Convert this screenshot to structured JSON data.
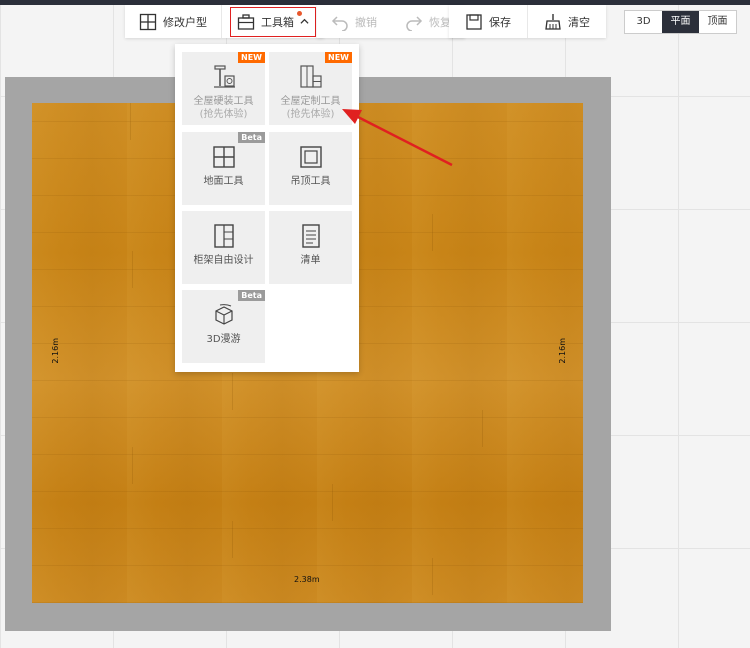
{
  "toolbar": {
    "edit_floorplan": "修改户型",
    "toolbox": "工具箱",
    "undo": "撤销",
    "redo": "恢复",
    "save": "保存",
    "clear": "清空"
  },
  "view_modes": [
    "3D",
    "平面",
    "顶面"
  ],
  "active_view": "平面",
  "dropdown": {
    "tiles": [
      {
        "label": "全屋硬装工具",
        "sub": "(抢先体验)",
        "badge": "NEW",
        "icon": "hard-decoration-icon"
      },
      {
        "label": "全屋定制工具",
        "sub": "(抢先体验)",
        "badge": "NEW",
        "icon": "custom-cabinet-icon"
      },
      {
        "label": "地面工具",
        "badge": "Beta",
        "icon": "floor-grid-icon"
      },
      {
        "label": "吊顶工具",
        "icon": "ceiling-icon"
      },
      {
        "label": "柜架自由设计",
        "icon": "cabinet-design-icon"
      },
      {
        "label": "清单",
        "icon": "list-icon"
      },
      {
        "label": "3D漫游",
        "badge": "Beta",
        "icon": "3d-roam-icon"
      }
    ]
  },
  "floorplan": {
    "width_label": "2.38m",
    "left_height_label": "2.16m",
    "right_height_label": "2.16m"
  },
  "colors": {
    "accent_dark": "#2b2f3a",
    "badge_new": "#ff6a00",
    "badge_beta": "#9b9b9b",
    "annotation_red": "#e02020",
    "wall": "#a5a5a5",
    "wood": "#c88417"
  }
}
